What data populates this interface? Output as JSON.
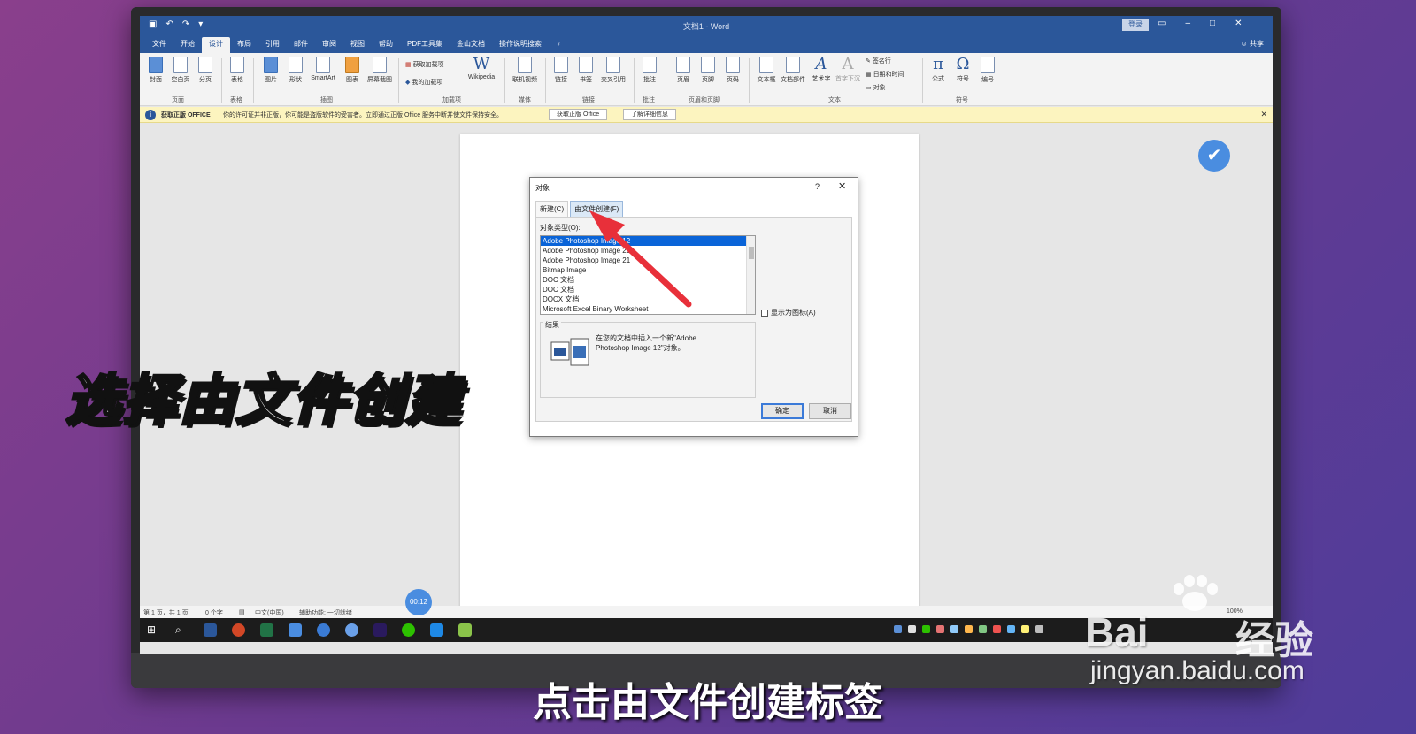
{
  "window": {
    "title": "文档1 - Word",
    "signin": "登录",
    "share": "共享"
  },
  "tabs": [
    "文件",
    "开始",
    "设计",
    "布局",
    "引用",
    "邮件",
    "审阅",
    "视图",
    "帮助",
    "PDF工具集",
    "金山文档",
    "操作说明搜索"
  ],
  "ribbon": {
    "buttons": [
      "封面",
      "空白页",
      "分页",
      "表格",
      "图片",
      "形状",
      "SmartArt",
      "图表",
      "屏幕截图",
      "Wikipedia",
      "联机视频",
      "链接",
      "书签",
      "交叉引用",
      "批注",
      "页眉",
      "页脚",
      "页码",
      "文本框",
      "文档部件",
      "艺术字",
      "首字下沉",
      "公式",
      "符号",
      "编号"
    ],
    "small_items": [
      "获取加载项",
      "我的加载项",
      "签名行",
      "日期和时间",
      "对象"
    ],
    "groups": [
      "页面",
      "表格",
      "插图",
      "加载项",
      "媒体",
      "链接",
      "批注",
      "页眉和页脚",
      "文本",
      "符号"
    ]
  },
  "infobar": {
    "title": "获取正版 OFFICE",
    "message": "你的许可证并非正版，你可能是盗版软件的受害者。立即通过正版 Office 服务中断并使文件保持安全。",
    "btn_genuine": "获取正版 Office",
    "btn_learn": "了解详细信息"
  },
  "dialog": {
    "title": "对象",
    "help": "?",
    "tab_new": "新建(C)",
    "tab_from_file": "由文件创建(F)",
    "type_label": "对象类型(O):",
    "items": [
      "Adobe Photoshop Image 12",
      "Adobe Photoshop Image 20",
      "Adobe Photoshop Image 21",
      "Bitmap Image",
      "DOC 文档",
      "DOC 文档",
      "DOCX 文档",
      "Microsoft Excel Binary Worksheet"
    ],
    "selected_index": 0,
    "display_as_icon": "显示为图标(A)",
    "result_label": "结果",
    "result_text": "在您的文档中插入一个新\"Adobe Photoshop Image 12\"对象。",
    "ok": "确定",
    "cancel": "取消"
  },
  "status": {
    "page": "第 1 页，共 1 页",
    "words": "0 个字",
    "lang": "中文(中国)",
    "accessibility": "辅助功能: 一切就绪",
    "zoom": "100%"
  },
  "timer": "00:12",
  "captions": {
    "side": "选择由文件创建",
    "bottom": "点击由文件创建标签"
  },
  "watermark": {
    "brand_bai": "Bai",
    "brand_jy": "经验",
    "url": "jingyan.baidu.com"
  },
  "colors": {
    "word_blue": "#2b579a",
    "arrow_red": "#e8303a",
    "selection": "#0a64d8"
  }
}
